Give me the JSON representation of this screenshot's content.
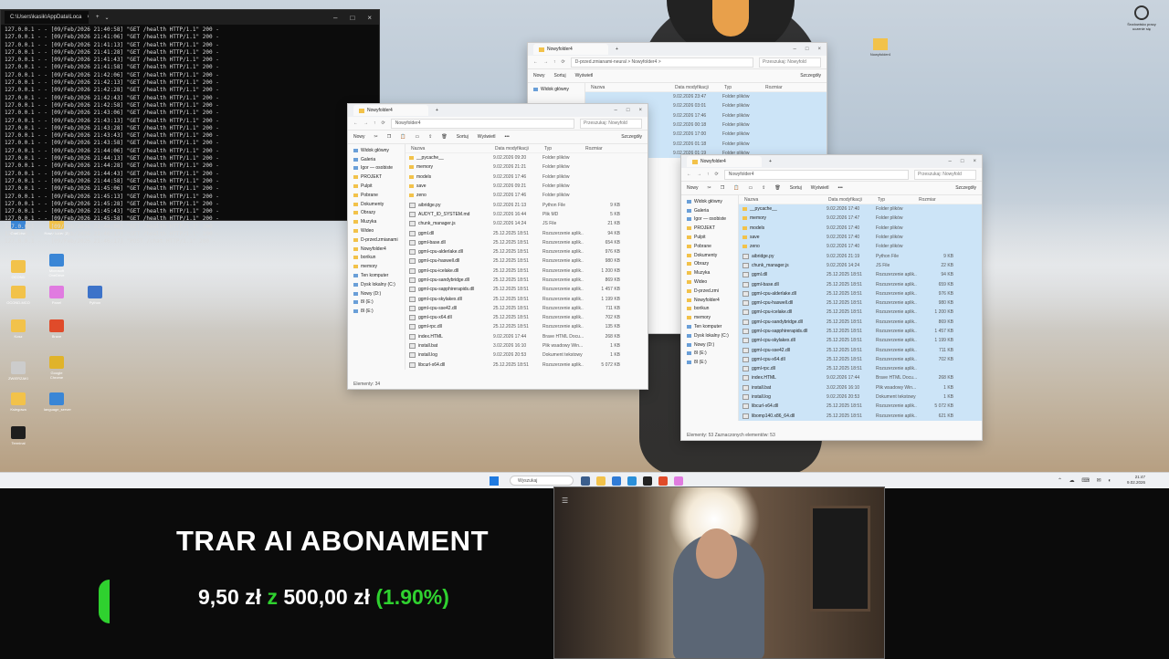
{
  "terminal": {
    "tab_title": "C:\\Users\\kasik\\AppData\\Loca",
    "lines": [
      "127.0.0.1 - - [09/Feb/2026 21:40:58] \"GET /health HTTP/1.1\" 200 -",
      "127.0.0.1 - - [09/Feb/2026 21:41:06] \"GET /health HTTP/1.1\" 200 -",
      "127.0.0.1 - - [09/Feb/2026 21:41:13] \"GET /health HTTP/1.1\" 200 -",
      "127.0.0.1 - - [09/Feb/2026 21:41:28] \"GET /health HTTP/1.1\" 200 -",
      "127.0.0.1 - - [09/Feb/2026 21:41:43] \"GET /health HTTP/1.1\" 200 -",
      "127.0.0.1 - - [09/Feb/2026 21:41:58] \"GET /health HTTP/1.1\" 200 -",
      "127.0.0.1 - - [09/Feb/2026 21:42:06] \"GET /health HTTP/1.1\" 200 -",
      "127.0.0.1 - - [09/Feb/2026 21:42:13] \"GET /health HTTP/1.1\" 200 -",
      "127.0.0.1 - - [09/Feb/2026 21:42:28] \"GET /health HTTP/1.1\" 200 -",
      "127.0.0.1 - - [09/Feb/2026 21:42:43] \"GET /health HTTP/1.1\" 200 -",
      "127.0.0.1 - - [09/Feb/2026 21:42:58] \"GET /health HTTP/1.1\" 200 -",
      "127.0.0.1 - - [09/Feb/2026 21:43:06] \"GET /health HTTP/1.1\" 200 -",
      "127.0.0.1 - - [09/Feb/2026 21:43:13] \"GET /health HTTP/1.1\" 200 -",
      "127.0.0.1 - - [09/Feb/2026 21:43:28] \"GET /health HTTP/1.1\" 200 -",
      "127.0.0.1 - - [09/Feb/2026 21:43:43] \"GET /health HTTP/1.1\" 200 -",
      "127.0.0.1 - - [09/Feb/2026 21:43:58] \"GET /health HTTP/1.1\" 200 -",
      "127.0.0.1 - - [09/Feb/2026 21:44:06] \"GET /health HTTP/1.1\" 200 -",
      "127.0.0.1 - - [09/Feb/2026 21:44:13] \"GET /health HTTP/1.1\" 200 -",
      "127.0.0.1 - - [09/Feb/2026 21:44:28] \"GET /health HTTP/1.1\" 200 -",
      "127.0.0.1 - - [09/Feb/2026 21:44:43] \"GET /health HTTP/1.1\" 200 -",
      "127.0.0.1 - - [09/Feb/2026 21:44:58] \"GET /health HTTP/1.1\" 200 -",
      "127.0.0.1 - - [09/Feb/2026 21:45:06] \"GET /health HTTP/1.1\" 200 -",
      "127.0.0.1 - - [09/Feb/2026 21:45:13] \"GET /health HTTP/1.1\" 200 -",
      "127.0.0.1 - - [09/Feb/2026 21:45:28] \"GET /health HTTP/1.1\" 200 -",
      "127.0.0.1 - - [09/Feb/2026 21:45:43] \"GET /health HTTP/1.1\" 200 -",
      "127.0.0.1 - - [09/Feb/2026 21:45:58] \"GET /health HTTP/1.1\" 200 -",
      "127.0.0.1 - - [09/Feb/2026 21:46:06] \"GET /health HTTP/1.1\" 200 -",
      "127.0.0.1 - - [09/Feb/2026 21:46:13] \"GET /health HTTP/1.1\" 200 -",
      "127.0.0.1 - - [09/Feb/2026 21:46:17] \"POST /chat HTTP/1.1\" 200 -"
    ]
  },
  "desktop_icons": [
    {
      "label": "OneDrive",
      "color": "#3a86d6"
    },
    {
      "label": "Nowy folder (2)",
      "color": "#f2c24a"
    },
    {
      "label": "OCOND",
      "color": "#f2c24a"
    },
    {
      "label": "Microsoft OneDrive",
      "color": "#3a86d6"
    },
    {
      "label": "OCOND-MCO",
      "color": "#f2c24a"
    },
    {
      "label": "Panel",
      "color": "#e07be0"
    },
    {
      "label": "Python",
      "color": "#3d73c9"
    },
    {
      "label": "Kosz",
      "color": "#f2c24a"
    },
    {
      "label": "Brave",
      "color": "#e04b2a"
    },
    {
      "label": "ZWIERZAKI",
      "color": "#cccccc"
    },
    {
      "label": "Google Chrome",
      "color": "#e0b32a"
    },
    {
      "label": "Ksiegowa",
      "color": "#f2c24a"
    },
    {
      "label": "language_server",
      "color": "#3a86d6"
    },
    {
      "label": "Terminal",
      "color": "#1e1e1e"
    }
  ],
  "window_left": {
    "tab_title": "Nowyfolder4",
    "path": "Nowyfolder4",
    "search_placeholder": "Przeszukaj: Nowyfold",
    "toolbar": {
      "new": "Nowy",
      "sort": "Sortuj",
      "view": "Wyświetl",
      "more": "•••",
      "details": "Szczegóły"
    },
    "sidebar": [
      "Widok główny",
      "Galeria",
      "Igor — osobiste",
      "PROJEKT",
      "Pulpit",
      "Pobrane",
      "Dokumenty",
      "Obrazy",
      "Muzyka",
      "Wideo",
      "D-przed.zmianami",
      "Nowyfolder4",
      "borikun",
      "memory",
      "Ten komputer",
      "Dysk lokalny (C:)",
      "Nowy (D:)",
      "8I (E:)",
      "8I (E:)"
    ],
    "columns": {
      "name": "Nazwa",
      "date": "Data modyfikacji",
      "type": "Typ",
      "size": "Rozmiar"
    },
    "rows": [
      {
        "name": "__pycache__",
        "date": "9.02.2026 09:20",
        "type": "Folder plików",
        "size": "",
        "kind": "folder"
      },
      {
        "name": "memory",
        "date": "9.02.2026 21:21",
        "type": "Folder plików",
        "size": "",
        "kind": "folder"
      },
      {
        "name": "models",
        "date": "9.02.2026 17:46",
        "type": "Folder plików",
        "size": "",
        "kind": "folder"
      },
      {
        "name": "save",
        "date": "9.02.2026 09:21",
        "type": "Folder plików",
        "size": "",
        "kind": "folder"
      },
      {
        "name": "zeno",
        "date": "9.02.2026 17:46",
        "type": "Folder plików",
        "size": "",
        "kind": "folder"
      },
      {
        "name": "aibridge.py",
        "date": "9.02.2026 21:13",
        "type": "Python File",
        "size": "9 KB",
        "kind": "file"
      },
      {
        "name": "AUDYT_ID_SYSTEM.md",
        "date": "9.02.2026 16:44",
        "type": "Plik MD",
        "size": "5 KB",
        "kind": "file"
      },
      {
        "name": "chunk_manager.js",
        "date": "9.02.2026 14:24",
        "type": "JS File",
        "size": "21 KB",
        "kind": "file"
      },
      {
        "name": "ggml.dll",
        "date": "25.12.2025 18:51",
        "type": "Rozszerzenie aplik...",
        "size": "94 KB",
        "kind": "file"
      },
      {
        "name": "ggml-base.dll",
        "date": "25.12.2025 18:51",
        "type": "Rozszerzenie aplik...",
        "size": "654 KB",
        "kind": "file"
      },
      {
        "name": "ggml-cpu-alderlake.dll",
        "date": "25.12.2025 18:51",
        "type": "Rozszerzenie aplik...",
        "size": "976 KB",
        "kind": "file"
      },
      {
        "name": "ggml-cpu-haswell.dll",
        "date": "25.12.2025 18:51",
        "type": "Rozszerzenie aplik...",
        "size": "980 KB",
        "kind": "file"
      },
      {
        "name": "ggml-cpu-icelake.dll",
        "date": "25.12.2025 18:51",
        "type": "Rozszerzenie aplik...",
        "size": "1 200 KB",
        "kind": "file"
      },
      {
        "name": "ggml-cpu-sandybridge.dll",
        "date": "25.12.2025 18:51",
        "type": "Rozszerzenie aplik...",
        "size": "869 KB",
        "kind": "file"
      },
      {
        "name": "ggml-cpu-sapphirerapids.dll",
        "date": "25.12.2025 18:51",
        "type": "Rozszerzenie aplik...",
        "size": "1 457 KB",
        "kind": "file"
      },
      {
        "name": "ggml-cpu-skylakex.dll",
        "date": "25.12.2025 18:51",
        "type": "Rozszerzenie aplik...",
        "size": "1 199 KB",
        "kind": "file"
      },
      {
        "name": "ggml-cpu-sse42.dll",
        "date": "25.12.2025 18:51",
        "type": "Rozszerzenie aplik...",
        "size": "711 KB",
        "kind": "file"
      },
      {
        "name": "ggml-cpu-x64.dll",
        "date": "25.12.2025 18:51",
        "type": "Rozszerzenie aplik...",
        "size": "702 KB",
        "kind": "file"
      },
      {
        "name": "ggml-rpc.dll",
        "date": "25.12.2025 18:51",
        "type": "Rozszerzenie aplik...",
        "size": "135 KB",
        "kind": "file"
      },
      {
        "name": "index.HTML",
        "date": "9.02.2026 17:44",
        "type": "Brave HTML Docu...",
        "size": "268 KB",
        "kind": "file"
      },
      {
        "name": "install.bat",
        "date": "3.02.2026 16:10",
        "type": "Plik wsadowy Win...",
        "size": "1 KB",
        "kind": "file"
      },
      {
        "name": "install.log",
        "date": "9.02.2026 20:53",
        "type": "Dokument tekstowy",
        "size": "1 KB",
        "kind": "file"
      },
      {
        "name": "libcurl-x64.dll",
        "date": "25.12.2025 18:51",
        "type": "Rozszerzenie aplik...",
        "size": "5 072 KB",
        "kind": "file"
      }
    ],
    "status": "Elementy: 34"
  },
  "window_back": {
    "tab_title": "Nowyfolder4",
    "path": "D-przed.zmianami-neural  >  Nowyfolder4  >",
    "search_placeholder": "Przeszukaj: Nowyfold",
    "toolbar": {
      "new": "Nowy",
      "sort": "Sortuj",
      "view": "Wyświetl",
      "details": "Szczegóły"
    },
    "sidebar": [
      "Widok główny"
    ],
    "columns": {
      "name": "Nazwa",
      "date": "Data modyfikacji",
      "type": "Typ",
      "size": "Rozmiar"
    },
    "rows": [
      {
        "date": "9.02.2026 23:47",
        "type": "Folder plików"
      },
      {
        "date": "9.02.2026 03:01",
        "type": "Folder plików"
      },
      {
        "date": "9.02.2026 17:46",
        "type": "Folder plików"
      },
      {
        "date": "9.02.2026 00:18",
        "type": "Folder plików"
      },
      {
        "date": "9.02.2026 17:00",
        "type": "Folder plików"
      },
      {
        "date": "9.02.2026 01:18",
        "type": "Folder plików"
      },
      {
        "date": "9.02.2026 01:19",
        "type": "Folder plików"
      }
    ]
  },
  "window_right": {
    "tab_title": "Nowyfolder4",
    "path": "Nowyfolder4",
    "search_placeholder": "Przeszukaj: Nowyfold",
    "toolbar": {
      "new": "Nowy",
      "sort": "Sortuj",
      "view": "Wyświetl",
      "more": "•••",
      "details": "Szczegóły"
    },
    "sidebar": [
      "Widok główny",
      "Galeria",
      "Igor — osobiste",
      "PROJEKT",
      "Pulpit",
      "Pobrane",
      "Dokumenty",
      "Obrazy",
      "Muzyka",
      "Wideo",
      "D-przed.zmi",
      "Nowyfolder4",
      "borikun",
      "memory",
      "Ten komputer",
      "Dysk lokalny (C:)",
      "Nowy (D:)",
      "8I (E:)",
      "8I (E:)"
    ],
    "columns": {
      "name": "Nazwa",
      "date": "Data modyfikacji",
      "type": "Typ",
      "size": "Rozmiar"
    },
    "rows": [
      {
        "name": "__pycache__",
        "date": "9.02.2026 17:40",
        "type": "Folder plików",
        "size": "",
        "kind": "folder"
      },
      {
        "name": "memory",
        "date": "9.02.2026 17:47",
        "type": "Folder plików",
        "size": "",
        "kind": "folder"
      },
      {
        "name": "models",
        "date": "9.02.2026 17:40",
        "type": "Folder plików",
        "size": "",
        "kind": "folder"
      },
      {
        "name": "save",
        "date": "9.02.2026 17:40",
        "type": "Folder plików",
        "size": "",
        "kind": "folder"
      },
      {
        "name": "zeno",
        "date": "9.02.2026 17:40",
        "type": "Folder plików",
        "size": "",
        "kind": "folder"
      },
      {
        "name": "aibridge.py",
        "date": "9.02.2026 21:19",
        "type": "Python File",
        "size": "9 KB",
        "kind": "file"
      },
      {
        "name": "chunk_manager.js",
        "date": "9.02.2026 14:24",
        "type": "JS File",
        "size": "22 KB",
        "kind": "file"
      },
      {
        "name": "ggml.dll",
        "date": "25.12.2025 18:51",
        "type": "Rozszerzenie aplik...",
        "size": "94 KB",
        "kind": "file"
      },
      {
        "name": "ggml-base.dll",
        "date": "25.12.2025 18:51",
        "type": "Rozszerzenie aplik...",
        "size": "659 KB",
        "kind": "file"
      },
      {
        "name": "ggml-cpu-alderlake.dll",
        "date": "25.12.2025 18:51",
        "type": "Rozszerzenie aplik...",
        "size": "976 KB",
        "kind": "file"
      },
      {
        "name": "ggml-cpu-haswell.dll",
        "date": "25.12.2025 18:51",
        "type": "Rozszerzenie aplik...",
        "size": "980 KB",
        "kind": "file"
      },
      {
        "name": "ggml-cpu-icelake.dll",
        "date": "25.12.2025 18:51",
        "type": "Rozszerzenie aplik...",
        "size": "1 200 KB",
        "kind": "file"
      },
      {
        "name": "ggml-cpu-sandybridge.dll",
        "date": "25.12.2025 18:51",
        "type": "Rozszerzenie aplik...",
        "size": "869 KB",
        "kind": "file"
      },
      {
        "name": "ggml-cpu-sapphirerapids.dll",
        "date": "25.12.2025 18:51",
        "type": "Rozszerzenie aplik...",
        "size": "1 457 KB",
        "kind": "file"
      },
      {
        "name": "ggml-cpu-skylakex.dll",
        "date": "25.12.2025 18:51",
        "type": "Rozszerzenie aplik...",
        "size": "1 199 KB",
        "kind": "file"
      },
      {
        "name": "ggml-cpu-sse42.dll",
        "date": "25.12.2025 18:51",
        "type": "Rozszerzenie aplik...",
        "size": "711 KB",
        "kind": "file"
      },
      {
        "name": "ggml-cpu-x64.dll",
        "date": "25.12.2025 18:51",
        "type": "Rozszerzenie aplik...",
        "size": "702 KB",
        "kind": "file"
      },
      {
        "name": "ggml-rpc.dll",
        "date": "25.12.2025 18:51",
        "type": "Rozszerzenie aplik...",
        "size": "",
        "kind": "file"
      },
      {
        "name": "index.HTML",
        "date": "9.02.2026 17:44",
        "type": "Brave HTML Docu...",
        "size": "268 KB",
        "kind": "file"
      },
      {
        "name": "install.bat",
        "date": "3.02.2026 16:10",
        "type": "Plik wsadowy Win...",
        "size": "1 KB",
        "kind": "file"
      },
      {
        "name": "install.log",
        "date": "9.02.2026 20:53",
        "type": "Dokument tekstowy",
        "size": "1 KB",
        "kind": "file"
      },
      {
        "name": "libcurl-x64.dll",
        "date": "25.12.2025 18:51",
        "type": "Rozszerzenie aplik...",
        "size": "5 072 KB",
        "kind": "file"
      },
      {
        "name": "libomp140.x86_64.dll",
        "date": "25.12.2025 18:51",
        "type": "Rozszerzenie aplik...",
        "size": "621 KB",
        "kind": "file"
      }
    ],
    "status": "Elementy: 53     Zaznaczonych elementów: 53"
  },
  "desktop_folder_right": {
    "label": "Nowyfolder4"
  },
  "top_right_widget": {
    "label": "Środowisko pracy uczenie się"
  },
  "taskbar": {
    "search_placeholder": "Wyszukaj",
    "time": "21:47",
    "date": "9.02.2026",
    "tray": "⌃ ☁ ⌨ ✉ ◐"
  },
  "overlay": {
    "title": "TRAR AI ABONAMENT",
    "amount_current": "9,50 zł",
    "amount_sep": "z",
    "amount_goal": "500,00 zł",
    "percent": "(1.90%)",
    "progress_fraction": 0.019
  },
  "colors": {
    "accent_green": "#2fd12f",
    "folder": "#f2c24a",
    "selection": "#cce4f7"
  }
}
